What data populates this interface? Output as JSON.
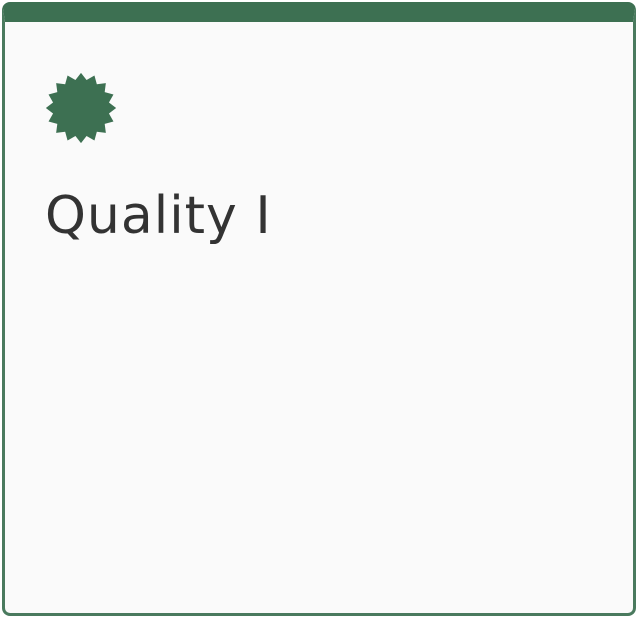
{
  "card": {
    "title": "Quality I",
    "icon": "badge-seal-icon",
    "accent_color": "#3d7052",
    "background_color": "#fafafa",
    "text_color": "#333333"
  }
}
